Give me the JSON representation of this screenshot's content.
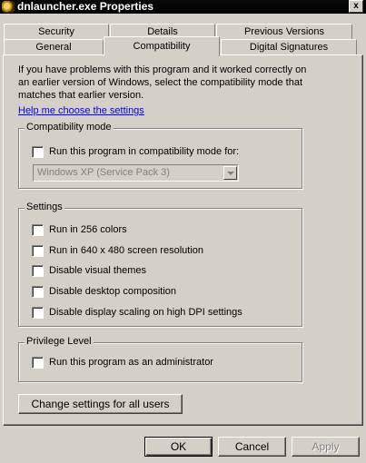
{
  "window": {
    "title": "dnlauncher.exe Properties",
    "close_glyph": "x"
  },
  "tabs_row1": [
    {
      "label": "Security"
    },
    {
      "label": "Details"
    },
    {
      "label": "Previous Versions"
    }
  ],
  "tabs_row2": [
    {
      "label": "General"
    },
    {
      "label": "Compatibility",
      "active": true
    },
    {
      "label": "Digital Signatures"
    }
  ],
  "intro": {
    "text": "If you have problems with this program and it worked correctly on an earlier version of Windows, select the compatibility mode that matches that earlier version.",
    "help_link": "Help me choose the settings"
  },
  "compatibility_mode": {
    "legend": "Compatibility mode",
    "checkbox_label": "Run this program in compatibility mode for:",
    "checked": false,
    "selected_os": "Windows XP (Service Pack 3)"
  },
  "settings": {
    "legend": "Settings",
    "items": [
      {
        "label": "Run in 256 colors",
        "checked": false
      },
      {
        "label": "Run in 640 x 480 screen resolution",
        "checked": false
      },
      {
        "label": "Disable visual themes",
        "checked": false
      },
      {
        "label": "Disable desktop composition",
        "checked": false
      },
      {
        "label": "Disable display scaling on high DPI settings",
        "checked": false
      }
    ]
  },
  "privilege": {
    "legend": "Privilege Level",
    "checkbox_label": "Run this program as an administrator",
    "checked": false
  },
  "buttons": {
    "change_all_users": "Change settings for all users",
    "ok": "OK",
    "cancel": "Cancel",
    "apply": "Apply"
  },
  "colors": {
    "dialog_bg": "#d4d0c8",
    "link": "#0000ff",
    "titlebar": "#000000"
  }
}
